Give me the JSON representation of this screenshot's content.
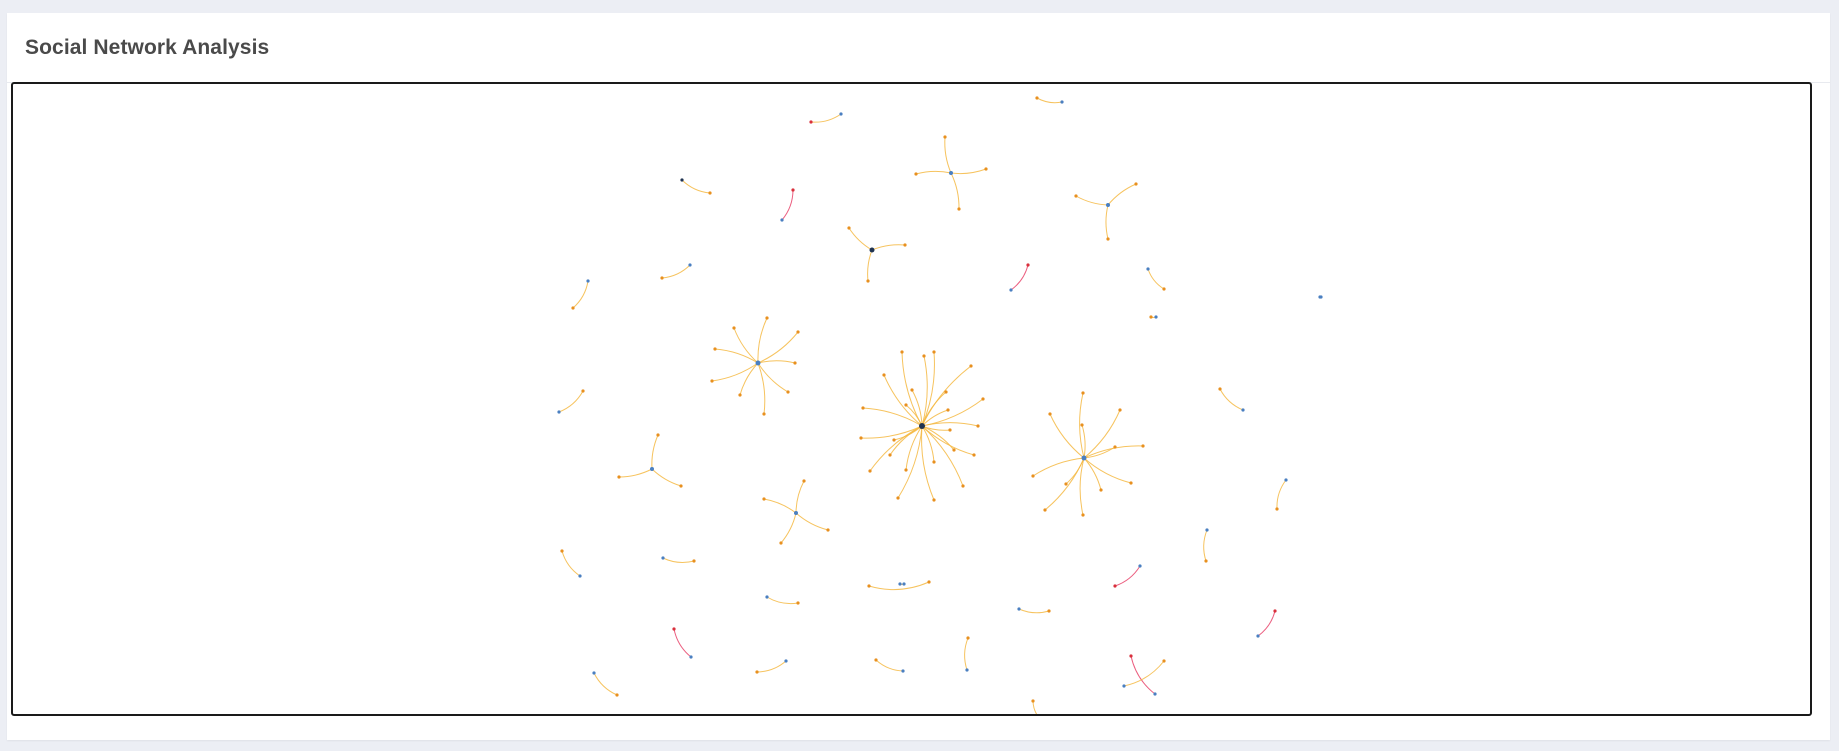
{
  "card": {
    "title": "Social Network Analysis"
  },
  "graph": {
    "colors": {
      "edge_default": "#f4b942",
      "edge_alert": "#e8436a",
      "node_orange": "#e8901f",
      "node_blue": "#4a7fc1",
      "node_red": "#d9303c",
      "node_dark": "#1f3350"
    }
  }
}
